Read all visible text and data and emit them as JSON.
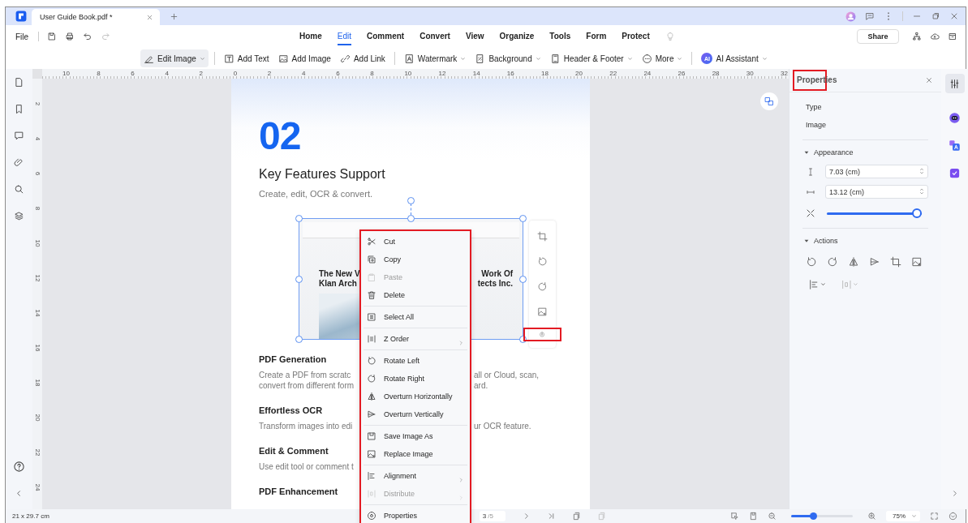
{
  "title_bar": {
    "tab": {
      "title": "User Guide Book.pdf *",
      "selected": true
    }
  },
  "menu_bar": {
    "file": "File",
    "tabs": [
      {
        "label": "Home",
        "selected": false
      },
      {
        "label": "Edit",
        "selected": true
      },
      {
        "label": "Comment",
        "selected": false
      },
      {
        "label": "Convert",
        "selected": false
      },
      {
        "label": "View",
        "selected": false
      },
      {
        "label": "Organize",
        "selected": false
      },
      {
        "label": "Tools",
        "selected": false
      },
      {
        "label": "Form",
        "selected": false
      },
      {
        "label": "Protect",
        "selected": false
      }
    ],
    "share": "Share"
  },
  "toolbar": {
    "groups": [
      [
        {
          "label": "Edit Image",
          "selected": true,
          "dropdown": true
        }
      ],
      [
        {
          "label": "Add Text",
          "selected": false,
          "dropdown": false
        },
        {
          "label": "Add Image",
          "selected": false,
          "dropdown": false
        },
        {
          "label": "Add Link",
          "selected": false,
          "dropdown": false
        }
      ],
      [
        {
          "label": "Watermark",
          "selected": false,
          "dropdown": true
        },
        {
          "label": "Background",
          "selected": false,
          "dropdown": true
        },
        {
          "label": "Header & Footer",
          "selected": false,
          "dropdown": true
        },
        {
          "label": "More",
          "selected": false,
          "dropdown": true
        }
      ],
      [
        {
          "label": "AI Assistant",
          "selected": false,
          "dropdown": true,
          "badge": "AI"
        }
      ]
    ]
  },
  "ruler": {
    "horizontal": [
      "10",
      "8",
      "6",
      "4",
      "2",
      "0",
      "2",
      "4",
      "6",
      "8",
      "10",
      "12",
      "14",
      "16",
      "18",
      "20",
      "22",
      "24",
      "26",
      "28",
      "30",
      "32"
    ],
    "vertical": [
      "2",
      "4",
      "6",
      "8",
      "10",
      "12",
      "14",
      "16",
      "18",
      "20",
      "22",
      "24"
    ]
  },
  "page": {
    "number": "02",
    "heading": "Key Features Support",
    "subtitle": "Create, edit, OCR & convert.",
    "image": {
      "captions": [
        {
          "left": "The New V",
          "right": "Work Of"
        },
        {
          "left": "Klan Arch",
          "right": "tects Inc."
        }
      ]
    },
    "sections": [
      {
        "title": "PDF Generation",
        "lines": [
          {
            "left": "Create a PDF from scratc",
            "right": "all or Cloud, scan,"
          },
          {
            "left": "convert from different form",
            "right": "ard."
          }
        ]
      },
      {
        "title": "Effortless OCR",
        "lines": [
          {
            "left": "Transform images into edi",
            "right": "ur OCR feature."
          }
        ]
      },
      {
        "title": "Edit & Comment",
        "lines": [
          {
            "left": "Use edit tool or comment t"
          }
        ]
      },
      {
        "title": "PDF Enhancement"
      }
    ]
  },
  "image_toolbar": {
    "buttons": [
      {
        "highlighted": false
      },
      {
        "highlighted": false
      },
      {
        "highlighted": false
      },
      {
        "highlighted": false
      },
      {
        "highlighted": true
      }
    ]
  },
  "context_menu": {
    "highlighted": true,
    "groups": [
      [
        {
          "label": "Cut",
          "disabled": false,
          "submenu": false
        },
        {
          "label": "Copy",
          "disabled": false,
          "submenu": false
        },
        {
          "label": "Paste",
          "disabled": true,
          "submenu": false
        },
        {
          "label": "Delete",
          "disabled": false,
          "submenu": false
        }
      ],
      [
        {
          "label": "Select All",
          "disabled": false,
          "submenu": false
        }
      ],
      [
        {
          "label": "Z Order",
          "disabled": false,
          "submenu": true
        }
      ],
      [
        {
          "label": "Rotate Left",
          "disabled": false,
          "submenu": false
        },
        {
          "label": "Rotate Right",
          "disabled": false,
          "submenu": false
        },
        {
          "label": "Overturn Horizontally",
          "disabled": false,
          "submenu": false
        },
        {
          "label": "Overturn Vertically",
          "disabled": false,
          "submenu": false
        }
      ],
      [
        {
          "label": "Save Image As",
          "disabled": false,
          "submenu": false
        },
        {
          "label": "Replace Image",
          "disabled": false,
          "submenu": false
        }
      ],
      [
        {
          "label": "Alignment",
          "disabled": false,
          "submenu": true
        },
        {
          "label": "Distribute",
          "disabled": true,
          "submenu": true
        }
      ],
      [
        {
          "label": "Properties",
          "disabled": false,
          "submenu": false
        }
      ]
    ]
  },
  "properties": {
    "title": "Properties",
    "title_highlighted": true,
    "type_label": "Type",
    "type_value": "Image",
    "appearance": {
      "label": "Appearance",
      "expanded": true,
      "height": "7.03 (cm)",
      "width": "13.12 (cm)",
      "scale": {
        "level": 1
      }
    },
    "actions": {
      "label": "Actions",
      "expanded": true
    }
  },
  "right_rail": {
    "items": [
      {
        "selected": true
      },
      {
        "selected": false
      },
      {
        "selected": false
      },
      {
        "selected": false
      }
    ]
  },
  "status_bar": {
    "page_size": "21 x 29.7 cm",
    "page": "3",
    "page_total": "/5",
    "zoom": {
      "level": 0.35
    },
    "zoom_value": "75%"
  }
}
